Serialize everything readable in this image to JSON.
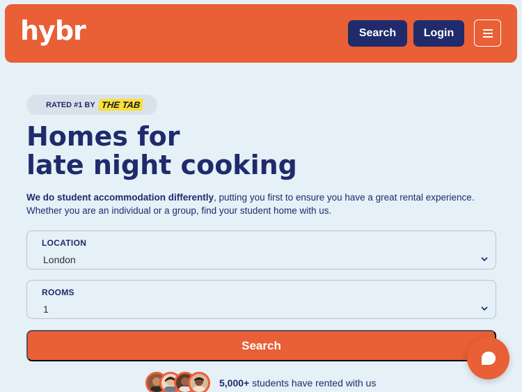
{
  "header": {
    "logo": "hybr",
    "search_label": "Search",
    "login_label": "Login",
    "menu_icon": "hamburger-menu-icon"
  },
  "badge": {
    "rated_text": "RATED #1 BY",
    "brand": "THE TAB"
  },
  "hero": {
    "title_line1": "Homes for",
    "title_line2": "late night cooking",
    "desc_bold": "We do student accommodation differently",
    "desc_rest": ", putting you first to ensure you have a great rental experience. Whether you are an individual or a group, find your student home with us."
  },
  "form": {
    "location_label": "LOCATION",
    "location_value": "London",
    "rooms_label": "ROOMS",
    "rooms_value": "1",
    "search_label": "Search"
  },
  "social": {
    "count": "5,000+",
    "text": " students have rented with us"
  },
  "colors": {
    "brand_orange": "#e95f36",
    "navy": "#1f2b6b",
    "background": "#e6f0f7"
  }
}
